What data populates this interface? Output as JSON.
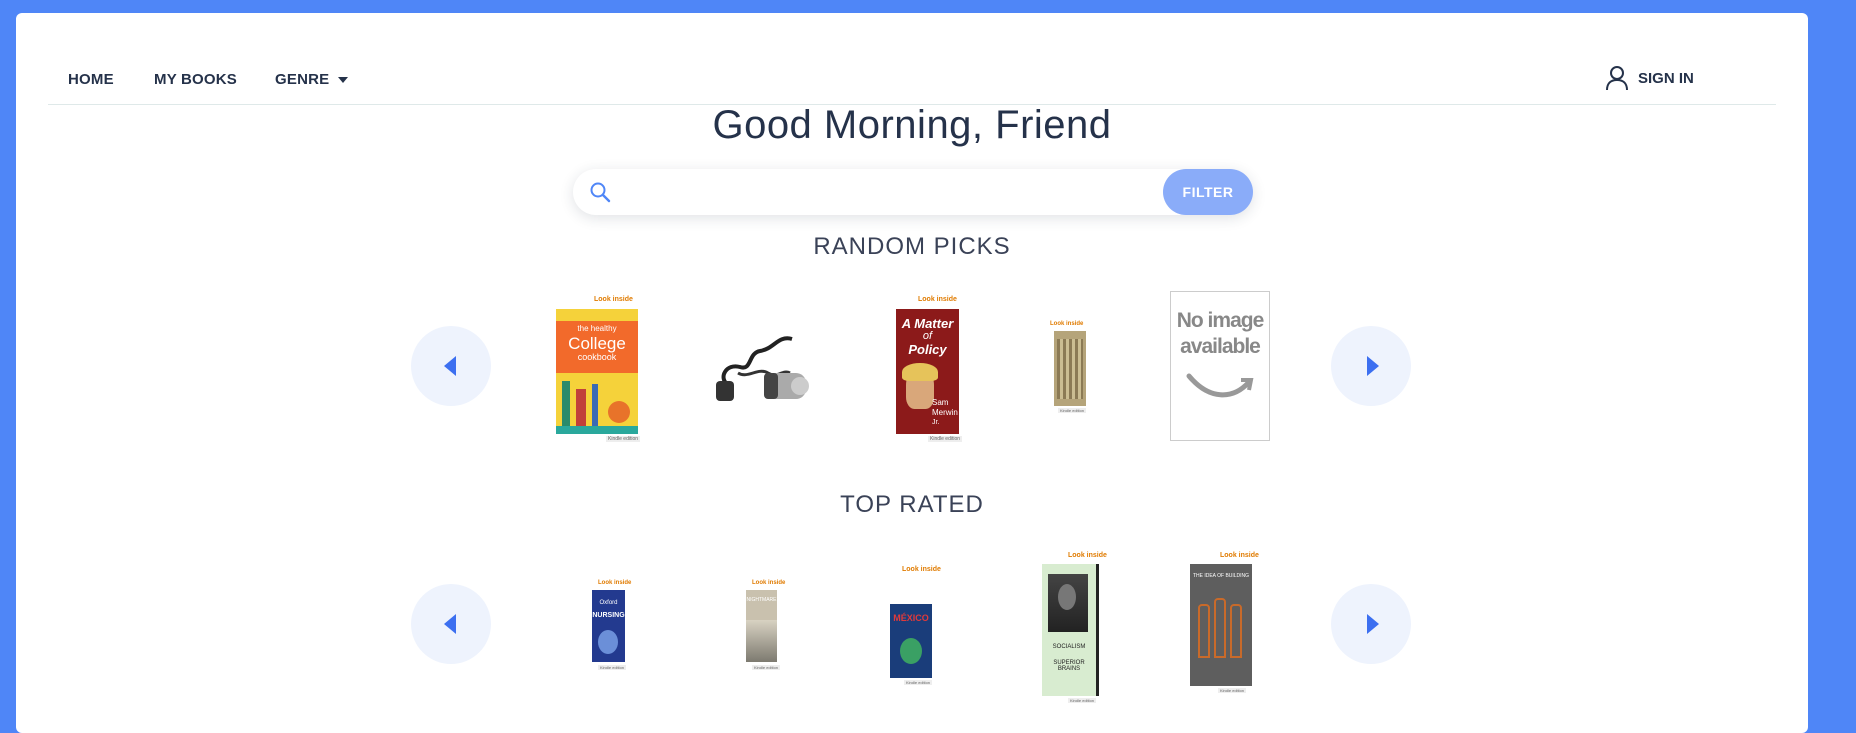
{
  "nav": {
    "home": "HOME",
    "my_books": "MY BOOKS",
    "genre": "GENRE",
    "sign_in": "SIGN IN"
  },
  "greeting": "Good Morning, Friend",
  "search": {
    "value": "",
    "placeholder": "",
    "filter_label": "FILTER"
  },
  "sections": {
    "random_picks": "RANDOM PICKS",
    "top_rated": "TOP RATED"
  },
  "book_badges": {
    "look_inside": "Look inside",
    "kindle_edition": "Kindle edition"
  },
  "random_books": [
    {
      "cover_lines": [
        "the healthy",
        "College",
        "cookbook"
      ]
    },
    {
      "cover_lines": []
    },
    {
      "cover_lines": [
        "A Matter",
        "of",
        "Policy",
        "Sam",
        "Merwin",
        "Jr."
      ]
    },
    {
      "cover_lines": []
    },
    {
      "cover_lines": [
        "No image",
        "available"
      ]
    }
  ],
  "top_books": [
    {
      "cover_lines": [
        "Oxford",
        "NURSING"
      ]
    },
    {
      "cover_lines": [
        "NIGHTMARE"
      ]
    },
    {
      "cover_lines": [
        "MÉXICO"
      ]
    },
    {
      "cover_lines": [
        "SOCIALISM",
        "SUPERIOR BRAINS"
      ]
    },
    {
      "cover_lines": [
        "THE IDEA OF BUILDING"
      ]
    }
  ],
  "colors": {
    "background": "#4f86f7",
    "accent": "#3c6ff0",
    "filter_button": "#8aacf9",
    "text": "#25324a"
  },
  "icons": {
    "user": "user-icon",
    "search": "search-icon",
    "prev": "chevron-left-icon",
    "next": "chevron-right-icon"
  }
}
